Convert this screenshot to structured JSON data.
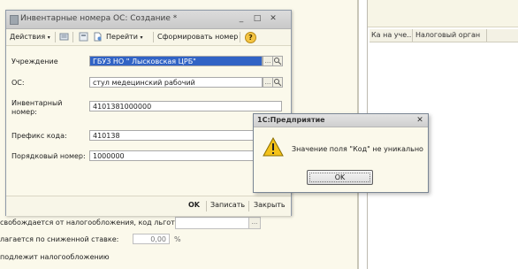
{
  "background": {
    "column_headers": [
      "Ка на уче...",
      "Налоговый орган"
    ],
    "fields": [
      {
        "label": "свобождается от налогообложения, код льготы",
        "value": ""
      },
      {
        "label": "лагается по сниженной ставке:",
        "value": "0,00",
        "suffix": "%"
      },
      {
        "label": "подлежит налогообложению",
        "value": ""
      }
    ]
  },
  "window": {
    "title": "Инвентарные номера ОС: Создание *",
    "toolbar": {
      "actions_label": "Действия",
      "goto_label": "Перейти",
      "generate_label": "Сформировать номер",
      "help_label": "?"
    },
    "form": {
      "institution_label": "Учреждение",
      "institution_value": "ГБУЗ НО \" Лысковская ЦРБ\"",
      "os_label": "ОС:",
      "os_value": "стул медецинский рабочий",
      "inventory_label_1": "Инвентарный",
      "inventory_label_2": "номер:",
      "inventory_value": "4101381000000",
      "prefix_label": "Префикс кода:",
      "prefix_value": "410138",
      "seq_label": "Порядковый номер:",
      "seq_value": "1000000"
    },
    "buttons": {
      "ok": "OK",
      "save": "Записать",
      "close": "Закрыть"
    }
  },
  "message_box": {
    "title": "1С:Предприятие",
    "text": "Значение поля \"Код\" не уникально",
    "ok": "OK"
  },
  "colors": {
    "selection": "#3163c5",
    "warning": "#f4c21a"
  }
}
